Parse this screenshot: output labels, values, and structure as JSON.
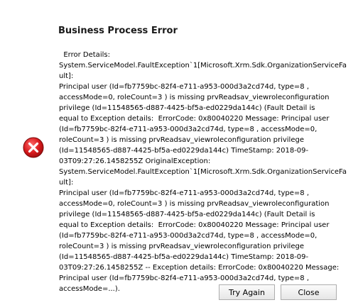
{
  "dialog": {
    "title": "Business Process Error",
    "icon": "error-circle-icon",
    "accent_color": "#c8102e",
    "message": "  Error Details:\nSystem.ServiceModel.FaultException`1[Microsoft.Xrm.Sdk.OrganizationServiceFault]:\nPrincipal user (Id=fb7759bc-82f4-e711-a953-000d3a2cd74d, type=8 ,\naccessMode=0, roleCount=3 ) is missing prvReadsav_viewroleconfiguration\nprivilege (Id=11548565-d887-4425-bf5a-ed0229da144c) (Fault Detail is\nequal to Exception details:  ErrorCode: 0x80040220 Message: Principal user\n(Id=fb7759bc-82f4-e711-a953-000d3a2cd74d, type=8 , accessMode=0,\nroleCount=3 ) is missing prvReadsav_viewroleconfiguration privilege\n(Id=11548565-d887-4425-bf5a-ed0229da144c) TimeStamp: 2018-09-\n03T09:27:26.1458255Z OriginalException:\nSystem.ServiceModel.FaultException`1[Microsoft.Xrm.Sdk.OrganizationServiceFault]:\nPrincipal user (Id=fb7759bc-82f4-e711-a953-000d3a2cd74d, type=8 ,\naccessMode=0, roleCount=3 ) is missing prvReadsav_viewroleconfiguration\nprivilege (Id=11548565-d887-4425-bf5a-ed0229da144c) (Fault Detail is\nequal to Exception details:  ErrorCode: 0x80040220 Message: Principal user\n(Id=fb7759bc-82f4-e711-a953-000d3a2cd74d, type=8 , accessMode=0,\nroleCount=3 ) is missing prvReadsav_viewroleconfiguration privilege\n(Id=11548565-d887-4425-bf5a-ed0229da144c) TimeStamp: 2018-09-\n03T09:27:26.1458255Z -- Exception details: ErrorCode: 0x80040220 Message:\nPrincipal user (Id=fb7759bc-82f4-e711-a953-000d3a2cd74d, type=8 ,\naccessMode=...)."
  },
  "buttons": {
    "try_again": "Try Again",
    "close": "Close"
  }
}
